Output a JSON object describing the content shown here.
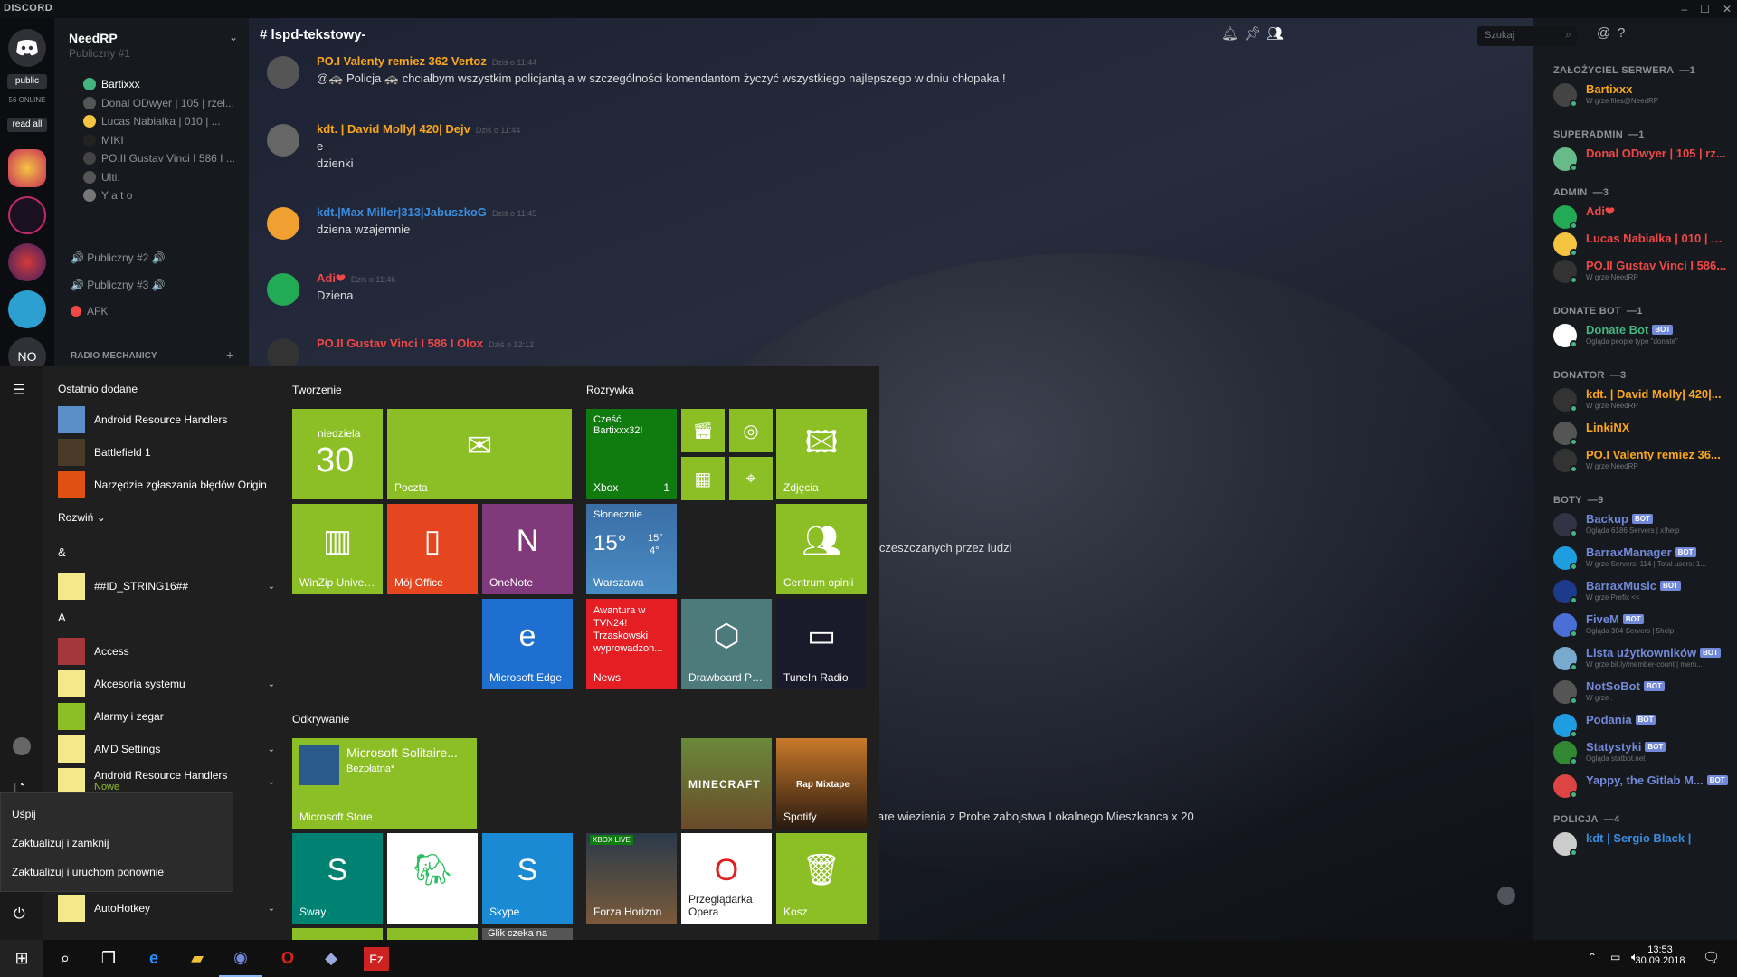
{
  "window": {
    "brand": "DISCORD",
    "minimize": "–",
    "maximize": "☐",
    "close": "✕"
  },
  "guilds": {
    "public": "public",
    "online": "56 ONLINE",
    "read_all": "read all",
    "no": "NO"
  },
  "server": {
    "name": "NeedRP",
    "top_partial": "Publiczny #1"
  },
  "voice_users": [
    "Bartixxx",
    "Donal ODwyer | 105 | rzel...",
    "Lucas Nabialka | 010 | ...",
    "MIKI",
    "PO.II Gustav Vinci I 586 I ...",
    "Ulti.",
    "Y a t o"
  ],
  "voice_channels": [
    "🔊 Publiczny #2 🔊",
    "🔊 Publiczny #3 🔊",
    "AFK"
  ],
  "category": "RADIO MECHANICY",
  "chat": {
    "channel": "lspd-tekstowy-",
    "messages": [
      {
        "author": "PO.I Valenty remiez 362 Vertoz",
        "color": "#faa61a",
        "time": "Dziś o 11:44",
        "lines": [
          "@🚓 Policja 🚓 chciałbym wszystkim policjantą a w szczególności komendantom życzyć wszystkiego najlepszego w dniu chłopaka !"
        ]
      },
      {
        "author": "kdt. | David Molly| 420| Dejv",
        "color": "#faa61a",
        "time": "Dziś o 11:44",
        "lines": [
          "e",
          "dzienki"
        ]
      },
      {
        "author": "kdt.|Max Miller|313|JabuszkoG",
        "color": "#3a8dde",
        "time": "Dziś o 11:45",
        "lines": [
          "dziena wzajemnie"
        ]
      },
      {
        "author": "Adi❤",
        "color": "#f04747",
        "time": "Dziś o 11:46",
        "lines": [
          "Dziena"
        ]
      },
      {
        "author": "PO.II Gustav Vinci I 586 I Olox",
        "color": "#f04747",
        "time": "Dziś o 12:12",
        "lines": [
          ""
        ]
      }
    ],
    "partial_1": "iejsc uczeszczanych przez ludzi",
    "partial_2": "are wiezienia z Probe zabojstwa Lokalnego Mieszkanca x 20",
    "search_placeholder": "Szukaj"
  },
  "members": {
    "sections": [
      {
        "title": "ZAŁOŻYCIEL SERWERA",
        "count": "—1",
        "items": [
          {
            "name": "Bartixxx",
            "color": "#faa61a",
            "status": "W grze files@NeedRP"
          }
        ]
      },
      {
        "title": "SUPERADMIN",
        "count": "—1",
        "items": [
          {
            "name": "Donal ODwyer | 105 | rz...",
            "color": "#f04747",
            "status": ""
          }
        ]
      },
      {
        "title": "ADMIN",
        "count": "—3",
        "items": [
          {
            "name": "Adi❤",
            "color": "#f04747",
            "status": ""
          },
          {
            "name": "Lucas Nabialka | 010 | m...",
            "color": "#f04747",
            "status": ""
          },
          {
            "name": "PO.II Gustav Vinci I 586...",
            "color": "#f04747",
            "status": "W grze NeedRP"
          }
        ]
      },
      {
        "title": "DONATE BOT",
        "count": "—1",
        "items": [
          {
            "name": "Donate Bot",
            "color": "#43b581",
            "status": "Ogląda people type \"donate\"",
            "bot": "BOT"
          }
        ]
      },
      {
        "title": "DONATOR",
        "count": "—3",
        "items": [
          {
            "name": "kdt. | David Molly| 420|...",
            "color": "#faa61a",
            "status": "W grze NeedRP"
          },
          {
            "name": "LinkiNX",
            "color": "#faa61a",
            "status": ""
          },
          {
            "name": "PO.I Valenty remiez 36...",
            "color": "#faa61a",
            "status": "W grze NeedRP"
          }
        ]
      },
      {
        "title": "BOTY",
        "count": "—9",
        "items": [
          {
            "name": "Backup",
            "color": "#7289da",
            "status": "Ogląda 6186 Servers | x!help",
            "bot": "BOT"
          },
          {
            "name": "BarraxManager",
            "color": "#7289da",
            "status": "W grze Servers: 114 | Total users: 1...",
            "bot": "BOT"
          },
          {
            "name": "BarraxMusic",
            "color": "#7289da",
            "status": "W grze Prefix <<",
            "bot": "BOT"
          },
          {
            "name": "FiveM",
            "color": "#7289da",
            "status": "Ogląda 304 Servers | 5help",
            "bot": "BOT"
          },
          {
            "name": "Lista użytkowników",
            "color": "#7289da",
            "status": "W grze bit.ly/member-count | mem...",
            "bot": "BOT"
          },
          {
            "name": "NotSoBot",
            "color": "#7289da",
            "status": "W grze .",
            "bot": "BOT"
          },
          {
            "name": "Podania",
            "color": "#7289da",
            "status": "",
            "bot": "BOT"
          },
          {
            "name": "Statystyki",
            "color": "#7289da",
            "status": "Ogląda statbot.net",
            "bot": "BOT"
          },
          {
            "name": "Yappy, the Gitlab M...",
            "color": "#7289da",
            "status": "",
            "bot": "BOT"
          }
        ]
      },
      {
        "title": "POLICJA",
        "count": "—4",
        "items": [
          {
            "name": "kdt | Sergio Black |",
            "color": "#3a8dde",
            "status": ""
          }
        ]
      }
    ]
  },
  "start": {
    "recent_header": "Ostatnio dodane",
    "recent": [
      "Android Resource Handlers",
      "Battlefield 1",
      "Narzędzie zgłaszania błędów Origin"
    ],
    "expand": "Rozwiń",
    "list": [
      {
        "letter": "&"
      },
      {
        "name": "##ID_STRING16##",
        "folder": true
      },
      {
        "letter": "A"
      },
      {
        "name": "Access",
        "folder": false
      },
      {
        "name": "Akcesoria systemu",
        "folder": true
      },
      {
        "name": "Alarmy i zegar",
        "folder": false
      },
      {
        "name": "AMD Settings",
        "folder": true
      },
      {
        "name": "Android Resource Handlers",
        "folder": true,
        "sub": "Nowe"
      }
    ],
    "list_bottom": "AutoHotkey",
    "power_menu": [
      "Uśpij",
      "Zaktualizuj i zamknij",
      "Zaktualizuj i uruchom ponownie"
    ],
    "groups": [
      "Tworzenie",
      "Rozrywka",
      "Odkrywanie"
    ],
    "tiles": {
      "calendar_day": "niedziela",
      "calendar_date": "30",
      "mail": "Poczta",
      "xbox_text": "Cześć Bartixxx32!",
      "xbox": "Xbox",
      "xbox_badge": "1",
      "photos": "Zdjęcia",
      "winzip": "WinZip Univer...",
      "office": "Mój Office",
      "onenote": "OneNote",
      "weather_cond": "Słonecznie",
      "weather_temp": "15°",
      "weather_hi": "15°",
      "weather_lo": "4°",
      "weather_city": "Warszawa",
      "feedback": "Centrum opinii",
      "edge": "Microsoft Edge",
      "news_text": "Awantura w TVN24! Trzaskowski wyprowadzon...",
      "news": "News",
      "drawboard": "Drawboard PDF",
      "tunein": "TuneIn Radio",
      "solitaire": "Microsoft Solitaire...",
      "solitaire_sub": "Bezpłatna*",
      "store": "Microsoft Store",
      "minecraft": "MINECRAFT",
      "spotify": "Spotify",
      "spotify_sub": "Rap Mixtape",
      "sway": "Sway",
      "skype": "Skype",
      "forza": "Forza Horizon",
      "xbox_live": "XBOX LIVE",
      "opera": "Przeglądarka Opera",
      "kosz": "Kosz",
      "glik": "Glik czeka na"
    }
  },
  "taskbar": {
    "time": "13:53",
    "date": "30.09.2018"
  }
}
